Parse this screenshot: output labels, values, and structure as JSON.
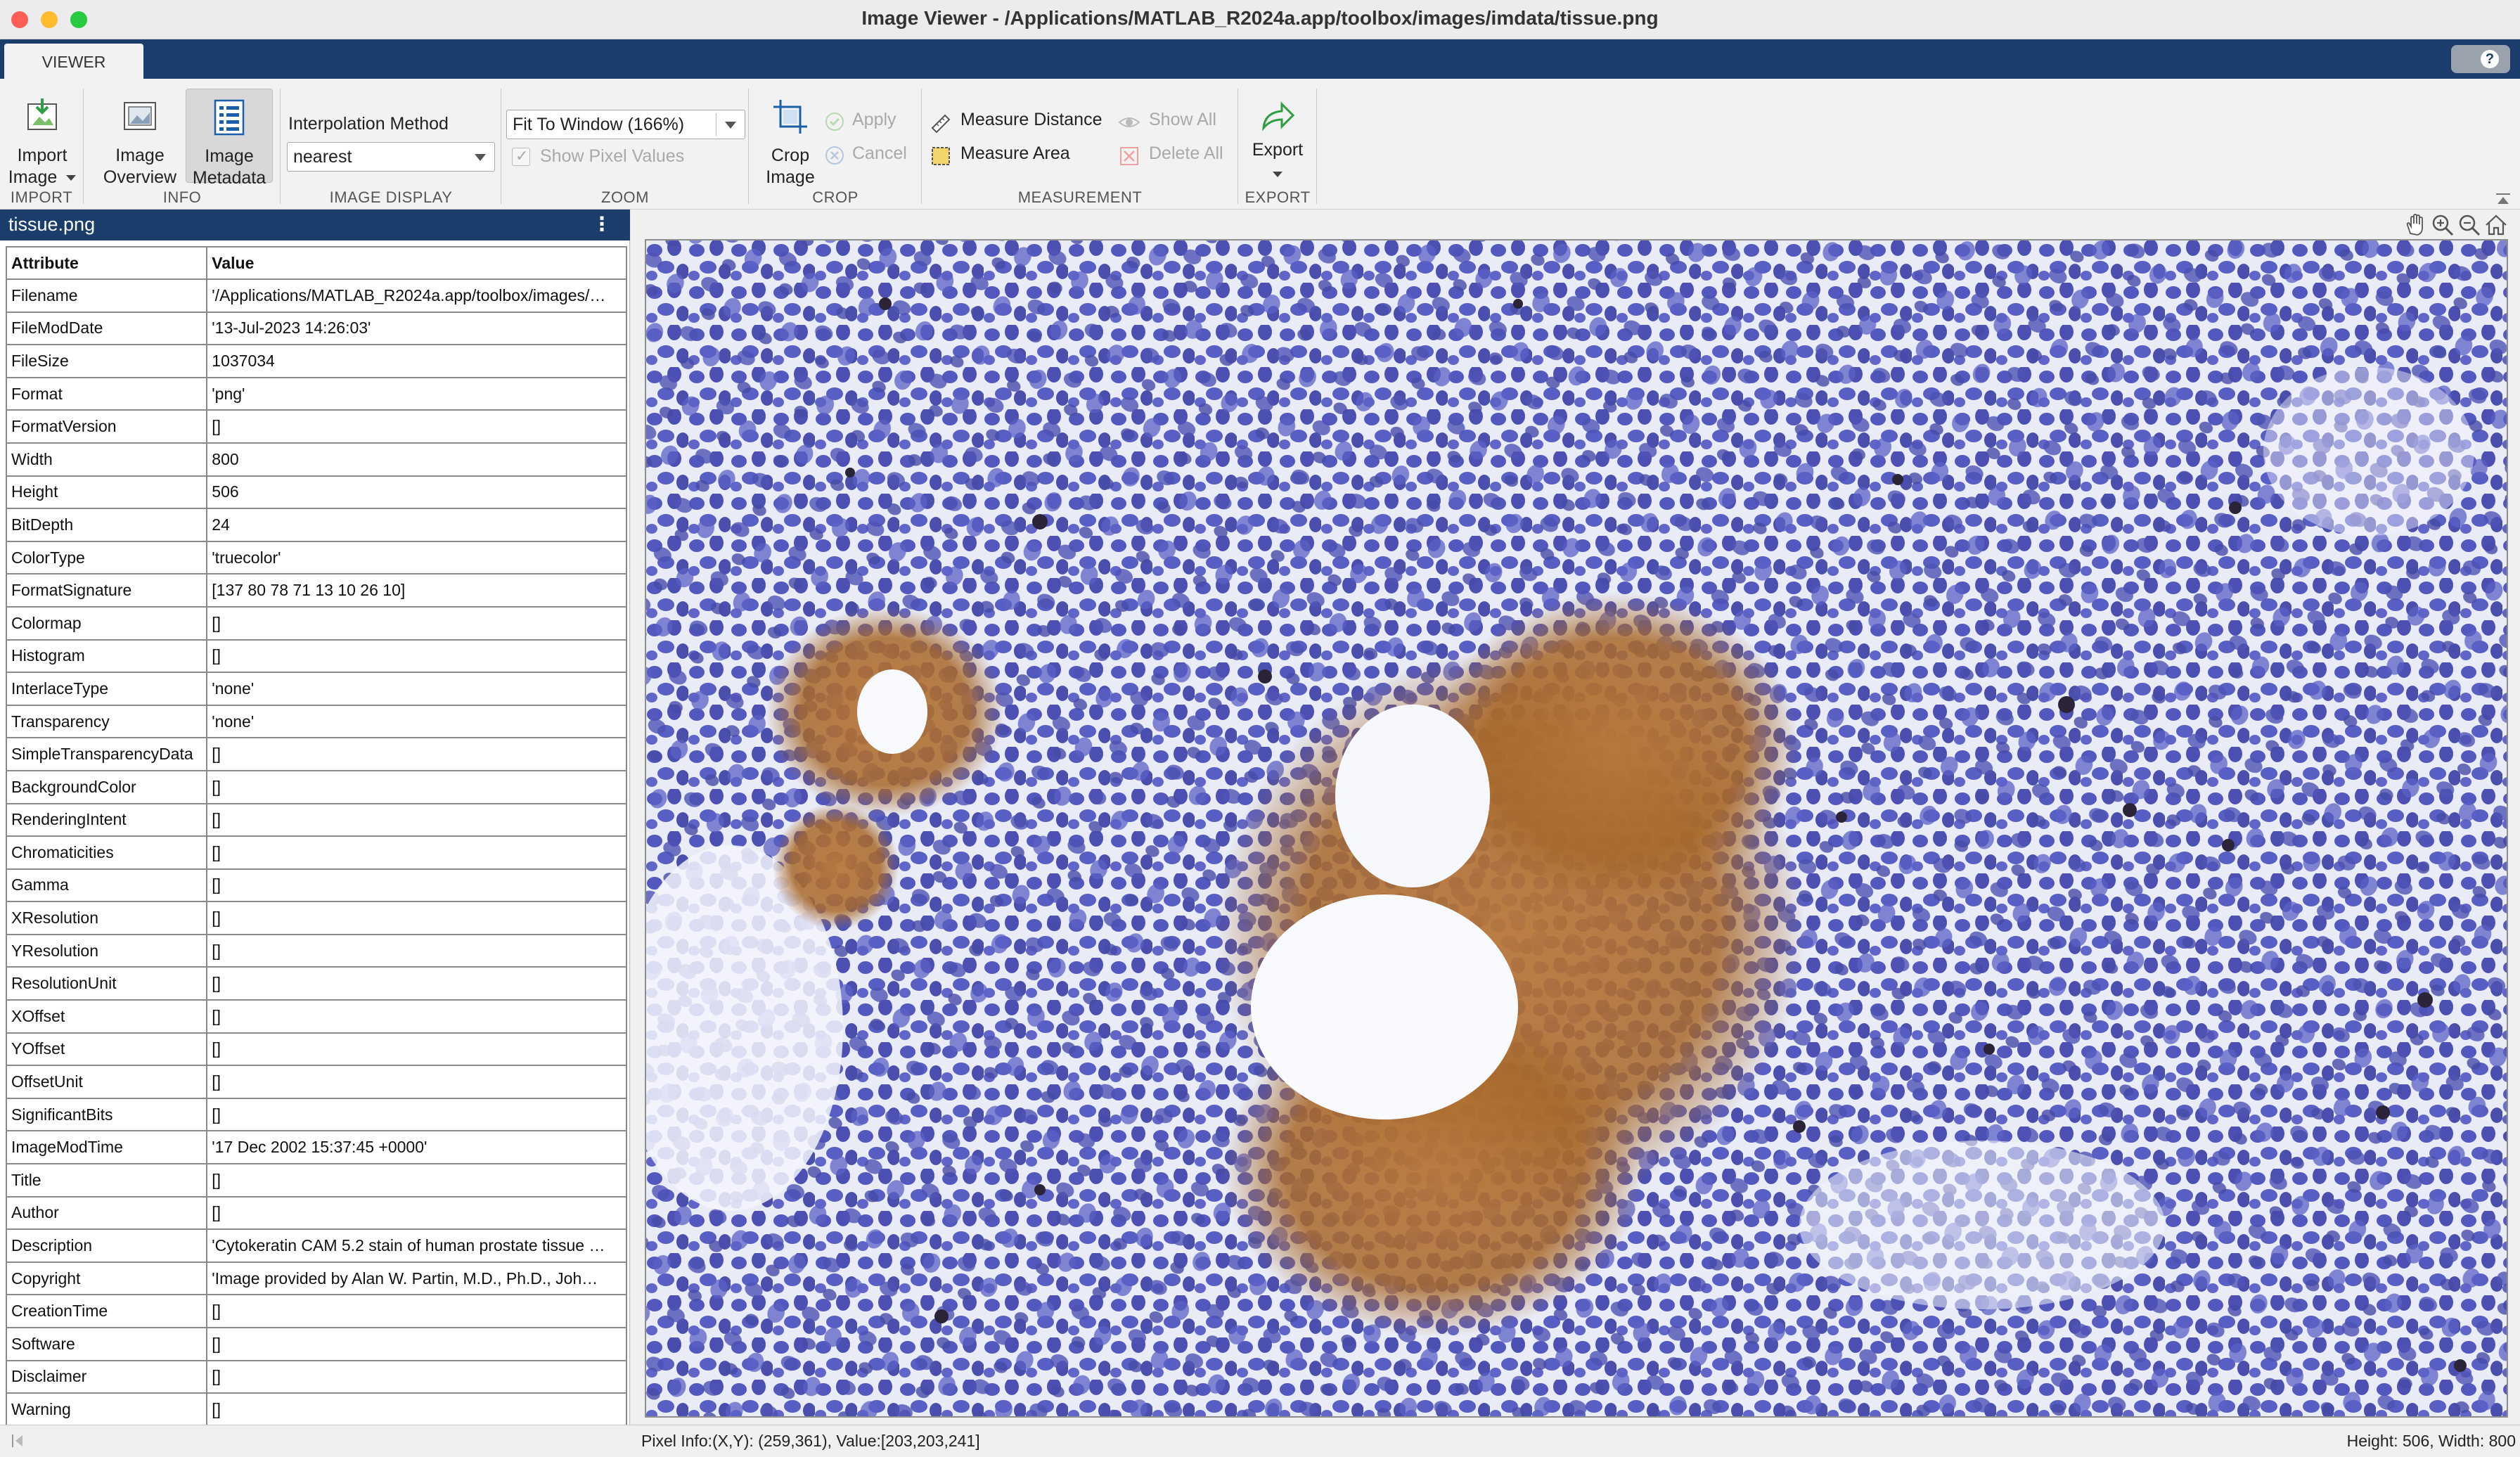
{
  "window": {
    "title": "Image Viewer - /Applications/MATLAB_R2024a.app/toolbox/images/imdata/tissue.png",
    "controls": {
      "close_color": "#ff5f57",
      "minimize_color": "#febc2e",
      "zoom_color": "#28c840"
    }
  },
  "tabs": {
    "active": "VIEWER",
    "help": "?"
  },
  "toolstrip": {
    "import": {
      "button": "Import Image",
      "button_line1": "Import",
      "button_line2": "Image",
      "section": "IMPORT"
    },
    "info": {
      "overview_line1": "Image",
      "overview_line2": "Overview",
      "metadata_line1": "Image",
      "metadata_line2": "Metadata",
      "section": "INFO"
    },
    "display": {
      "interp_label": "Interpolation Method",
      "interp_value": "nearest",
      "section": "IMAGE DISPLAY"
    },
    "zoom": {
      "zoom_value": "Fit To Window (166%)",
      "show_pixel_values": "Show Pixel Values",
      "section": "ZOOM"
    },
    "crop": {
      "crop_line1": "Crop",
      "crop_line2": "Image",
      "apply": "Apply",
      "cancel": "Cancel",
      "section": "CROP"
    },
    "measurement": {
      "measure_distance": "Measure Distance",
      "measure_area": "Measure Area",
      "show_all": "Show All",
      "delete_all": "Delete All",
      "section": "MEASUREMENT"
    },
    "export": {
      "button": "Export",
      "section": "EXPORT"
    }
  },
  "panel": {
    "title": "tissue.png",
    "menu": "⋮",
    "columns": [
      "Attribute",
      "Value"
    ],
    "rows": [
      [
        "Filename",
        "'/Applications/MATLAB_R2024a.app/toolbox/images/…"
      ],
      [
        "FileModDate",
        "'13-Jul-2023 14:26:03'"
      ],
      [
        "FileSize",
        "1037034"
      ],
      [
        "Format",
        "'png'"
      ],
      [
        "FormatVersion",
        "[]"
      ],
      [
        "Width",
        "800"
      ],
      [
        "Height",
        "506"
      ],
      [
        "BitDepth",
        "24"
      ],
      [
        "ColorType",
        "'truecolor'"
      ],
      [
        "FormatSignature",
        "[137 80 78 71 13 10 26 10]"
      ],
      [
        "Colormap",
        "[]"
      ],
      [
        "Histogram",
        "[]"
      ],
      [
        "InterlaceType",
        "'none'"
      ],
      [
        "Transparency",
        "'none'"
      ],
      [
        "SimpleTransparencyData",
        "[]"
      ],
      [
        "BackgroundColor",
        "[]"
      ],
      [
        "RenderingIntent",
        "[]"
      ],
      [
        "Chromaticities",
        "[]"
      ],
      [
        "Gamma",
        "[]"
      ],
      [
        "XResolution",
        "[]"
      ],
      [
        "YResolution",
        "[]"
      ],
      [
        "ResolutionUnit",
        "[]"
      ],
      [
        "XOffset",
        "[]"
      ],
      [
        "YOffset",
        "[]"
      ],
      [
        "OffsetUnit",
        "[]"
      ],
      [
        "SignificantBits",
        "[]"
      ],
      [
        "ImageModTime",
        "'17 Dec 2002 15:37:45 +0000'"
      ],
      [
        "Title",
        "[]"
      ],
      [
        "Author",
        "[]"
      ],
      [
        "Description",
        "'Cytokeratin CAM 5.2 stain of human prostate tissue …"
      ],
      [
        "Copyright",
        "'Image provided by Alan W. Partin, M.D., Ph.D., Joh…"
      ],
      [
        "CreationTime",
        "[]"
      ],
      [
        "Software",
        "[]"
      ],
      [
        "Disclaimer",
        "[]"
      ],
      [
        "Warning",
        "[]"
      ]
    ]
  },
  "viewer": {
    "tools": [
      "pan-hand-icon",
      "zoom-in-icon",
      "zoom-out-icon",
      "home-icon"
    ],
    "image_colors": {
      "background": "#e8ebf6",
      "nuclei": "#4f53b8",
      "stain": "#a8692a"
    }
  },
  "status": {
    "pixel_info": "Pixel Info:(X,Y): (259,361), Value:[203,203,241]",
    "dimensions": "Height: 506, Width: 800"
  }
}
